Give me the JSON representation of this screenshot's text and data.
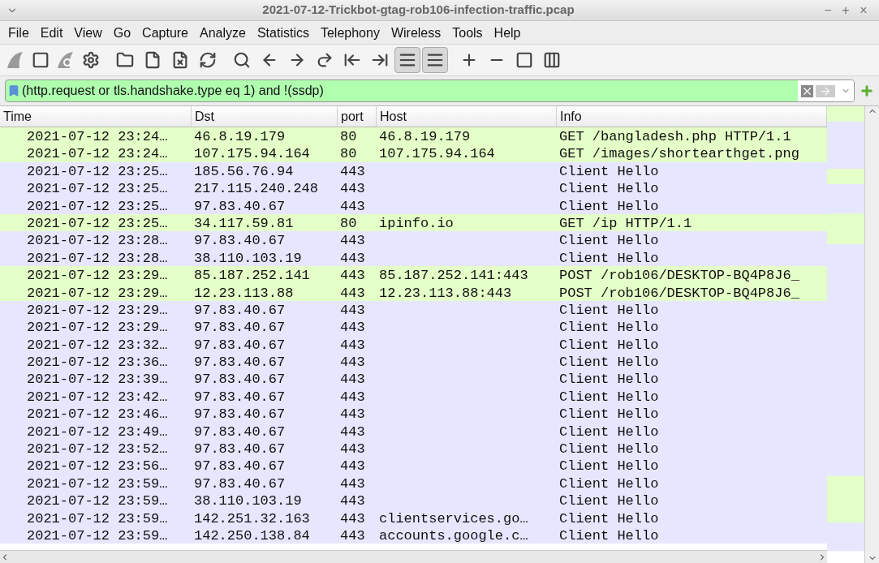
{
  "window": {
    "title": "2021-07-12-Trickbot-gtag-rob106-infection-traffic.pcap",
    "controls": [
      "−",
      "+",
      "×"
    ]
  },
  "menu": [
    "File",
    "Edit",
    "View",
    "Go",
    "Capture",
    "Analyze",
    "Statistics",
    "Telephony",
    "Wireless",
    "Tools",
    "Help"
  ],
  "toolbar": {
    "toggles": [
      {
        "pressed": true
      },
      {
        "pressed": true
      }
    ]
  },
  "filter": {
    "value": "(http.request or tls.handshake.type eq 1) and !(ssdp)",
    "valid": true
  },
  "table": {
    "columns": [
      "Time",
      "Dst",
      "port",
      "Host",
      "Info"
    ],
    "rows": [
      {
        "color": "#e4ffc7",
        "cells": [
          "2021-07-12 23:24…",
          "46.8.19.179",
          "80",
          "46.8.19.179",
          "GET /bangladesh.php HTTP/1.1"
        ]
      },
      {
        "color": "#e4ffc7",
        "cells": [
          "2021-07-12 23:24…",
          "107.175.94.164",
          "80",
          "107.175.94.164",
          "GET /images/shortearthget.png"
        ]
      },
      {
        "color": "#e7e6ff",
        "cells": [
          "2021-07-12 23:25…",
          "185.56.76.94",
          "443",
          "",
          "Client Hello"
        ]
      },
      {
        "color": "#e7e6ff",
        "cells": [
          "2021-07-12 23:25…",
          "217.115.240.248",
          "443",
          "",
          "Client Hello"
        ]
      },
      {
        "color": "#e7e6ff",
        "cells": [
          "2021-07-12 23:25…",
          "97.83.40.67",
          "443",
          "",
          "Client Hello"
        ]
      },
      {
        "color": "#e4ffc7",
        "cells": [
          "2021-07-12 23:25…",
          "34.117.59.81",
          "80",
          "ipinfo.io",
          "GET /ip HTTP/1.1"
        ]
      },
      {
        "color": "#e7e6ff",
        "cells": [
          "2021-07-12 23:28…",
          "97.83.40.67",
          "443",
          "",
          "Client Hello"
        ]
      },
      {
        "color": "#e7e6ff",
        "cells": [
          "2021-07-12 23:28…",
          "38.110.103.19",
          "443",
          "",
          "Client Hello"
        ]
      },
      {
        "color": "#e4ffc7",
        "cells": [
          "2021-07-12 23:29…",
          "85.187.252.141",
          "443",
          "85.187.252.141:443",
          "POST /rob106/DESKTOP-BQ4P8J6_"
        ]
      },
      {
        "color": "#e4ffc7",
        "cells": [
          "2021-07-12 23:29…",
          "12.23.113.88",
          "443",
          "12.23.113.88:443",
          "POST /rob106/DESKTOP-BQ4P8J6_"
        ]
      },
      {
        "color": "#e7e6ff",
        "cells": [
          "2021-07-12 23:29…",
          "97.83.40.67",
          "443",
          "",
          "Client Hello"
        ]
      },
      {
        "color": "#e7e6ff",
        "cells": [
          "2021-07-12 23:29…",
          "97.83.40.67",
          "443",
          "",
          "Client Hello"
        ]
      },
      {
        "color": "#e7e6ff",
        "cells": [
          "2021-07-12 23:32…",
          "97.83.40.67",
          "443",
          "",
          "Client Hello"
        ]
      },
      {
        "color": "#e7e6ff",
        "cells": [
          "2021-07-12 23:36…",
          "97.83.40.67",
          "443",
          "",
          "Client Hello"
        ]
      },
      {
        "color": "#e7e6ff",
        "cells": [
          "2021-07-12 23:39…",
          "97.83.40.67",
          "443",
          "",
          "Client Hello"
        ]
      },
      {
        "color": "#e7e6ff",
        "cells": [
          "2021-07-12 23:42…",
          "97.83.40.67",
          "443",
          "",
          "Client Hello"
        ]
      },
      {
        "color": "#e7e6ff",
        "cells": [
          "2021-07-12 23:46…",
          "97.83.40.67",
          "443",
          "",
          "Client Hello"
        ]
      },
      {
        "color": "#e7e6ff",
        "cells": [
          "2021-07-12 23:49…",
          "97.83.40.67",
          "443",
          "",
          "Client Hello"
        ]
      },
      {
        "color": "#e7e6ff",
        "cells": [
          "2021-07-12 23:52…",
          "97.83.40.67",
          "443",
          "",
          "Client Hello"
        ]
      },
      {
        "color": "#e7e6ff",
        "cells": [
          "2021-07-12 23:56…",
          "97.83.40.67",
          "443",
          "",
          "Client Hello"
        ]
      },
      {
        "color": "#e7e6ff",
        "cells": [
          "2021-07-12 23:59…",
          "97.83.40.67",
          "443",
          "",
          "Client Hello"
        ]
      },
      {
        "color": "#e7e6ff",
        "cells": [
          "2021-07-12 23:59…",
          "38.110.103.19",
          "443",
          "",
          "Client Hello"
        ]
      },
      {
        "color": "#e7e6ff",
        "cells": [
          "2021-07-12 23:59…",
          "142.251.32.163",
          "443",
          "clientservices.go…",
          "Client Hello"
        ]
      },
      {
        "color": "#e7e6ff",
        "cells": [
          "2021-07-12 23:59…",
          "142.250.138.84",
          "443",
          "accounts.google.c…",
          "Client Hello"
        ]
      }
    ]
  }
}
